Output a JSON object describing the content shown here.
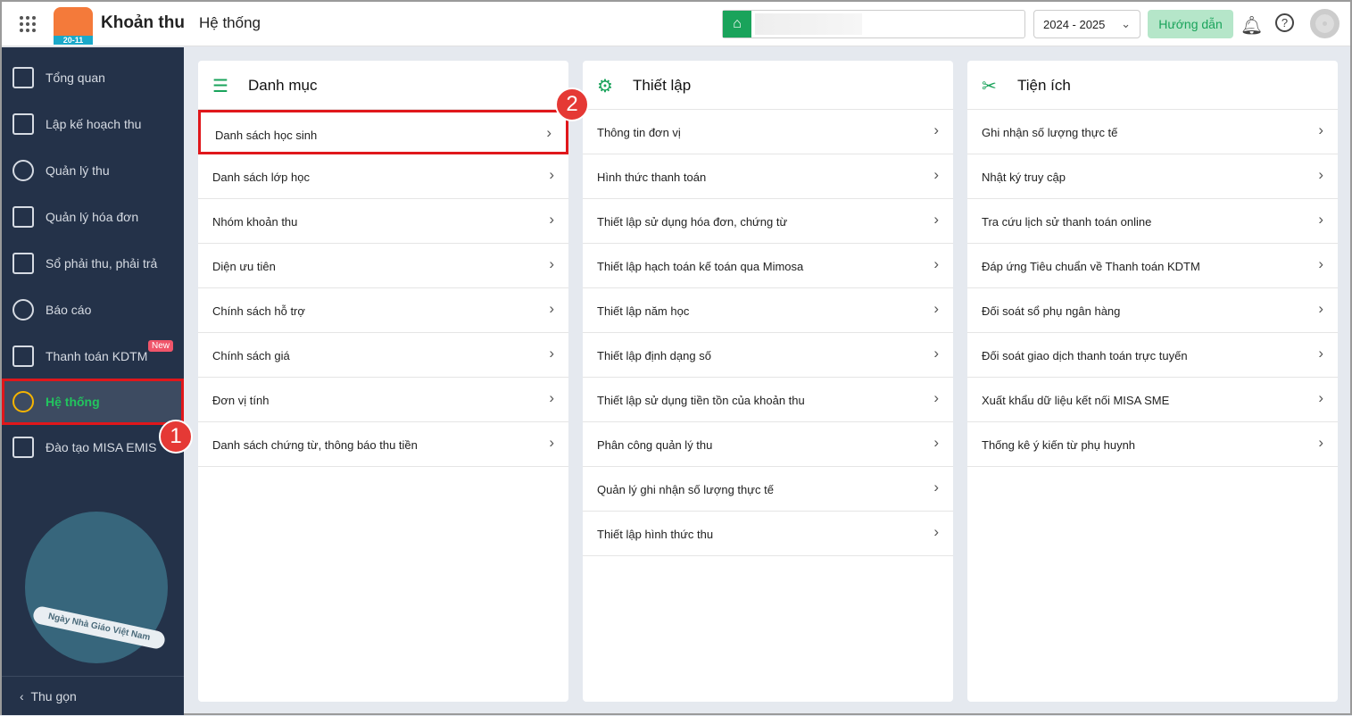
{
  "header": {
    "app_title": "Khoản thu",
    "section": "Hệ thống",
    "logo_text": "20-11",
    "year": "2024 - 2025",
    "guide_label": "Hướng dẫn"
  },
  "sidebar": {
    "items": [
      {
        "label": "Tổng quan"
      },
      {
        "label": "Lập kế hoạch thu"
      },
      {
        "label": "Quản lý thu"
      },
      {
        "label": "Quản lý hóa đơn"
      },
      {
        "label": "Sổ phải thu, phải trả"
      },
      {
        "label": "Báo cáo"
      },
      {
        "label": "Thanh toán KDTM",
        "badge": "New"
      },
      {
        "label": "Hệ thống"
      },
      {
        "label": "Đào tạo MISA EMIS"
      }
    ],
    "collapse": "Thu gọn",
    "banner_text": "Ngày Nhà Giáo Việt Nam"
  },
  "annotations": [
    "1",
    "2"
  ],
  "cards": [
    {
      "title": "Danh mục",
      "items": [
        "Danh sách học sinh",
        "Danh sách lớp học",
        "Nhóm khoản thu",
        "Diện ưu tiên",
        "Chính sách hỗ trợ",
        "Chính sách giá",
        "Đơn vị tính",
        "Danh sách chứng từ, thông báo thu tiền"
      ]
    },
    {
      "title": "Thiết lập",
      "items": [
        "Thông tin đơn vị",
        "Hình thức thanh toán",
        "Thiết lập sử dụng hóa đơn, chứng từ",
        "Thiết lập hạch toán kế toán qua Mimosa",
        "Thiết lập năm học",
        "Thiết lập định dạng số",
        "Thiết lập sử dụng tiền tồn của khoản thu",
        "Phân công quản lý thu",
        "Quản lý ghi nhận số lượng thực tế",
        "Thiết lập hình thức thu"
      ]
    },
    {
      "title": "Tiện ích",
      "items": [
        "Ghi nhận số lượng thực tế",
        "Nhật ký truy cập",
        "Tra cứu lịch sử thanh toán online",
        "Đáp ứng Tiêu chuẩn về Thanh toán KDTM",
        "Đối soát sổ phụ ngân hàng",
        "Đối soát giao dịch thanh toán trực tuyến",
        "Xuất khẩu dữ liệu kết nối MISA SME",
        "Thống kê ý kiến từ phụ huynh"
      ]
    }
  ]
}
